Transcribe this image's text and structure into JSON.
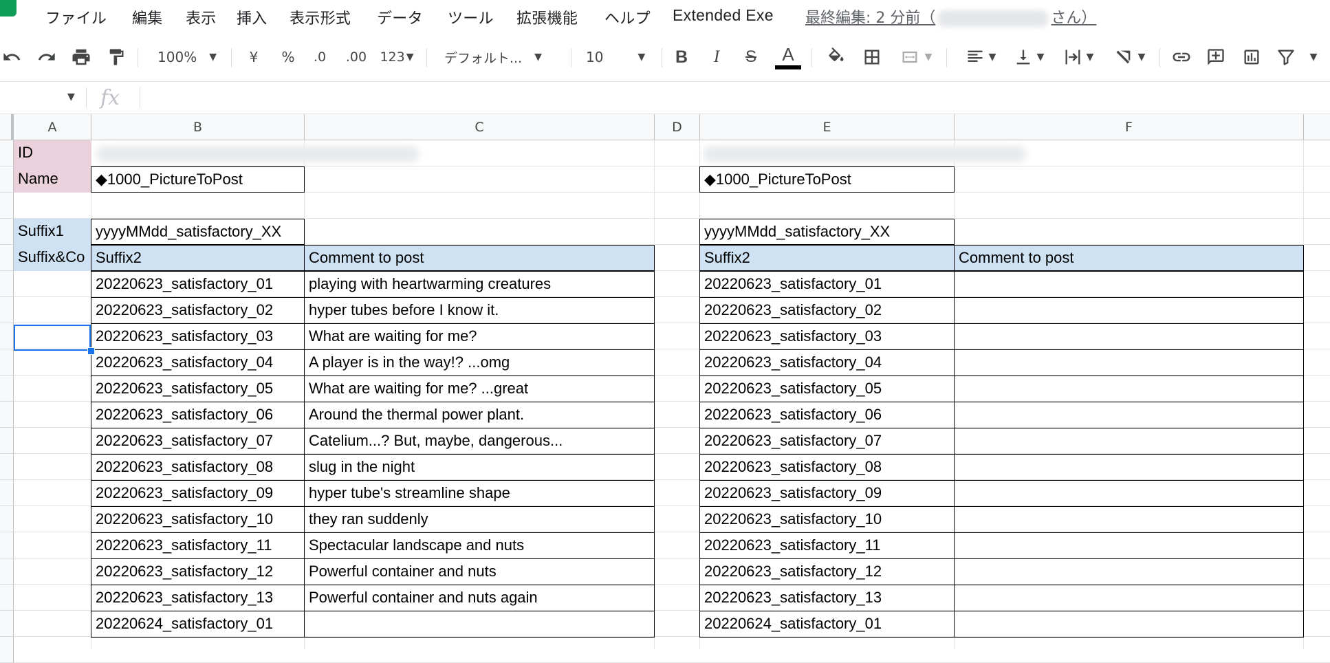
{
  "menu": {
    "items": [
      "ファイル",
      "編集",
      "表示",
      "挿入",
      "表示形式",
      "データ",
      "ツール",
      "拡張機能",
      "ヘルプ",
      "Extended Exe"
    ],
    "last_edit_prefix": "最終編集: 2 分前（",
    "last_edit_suffix": "さん）"
  },
  "toolbar": {
    "zoom": "100%",
    "currency": "¥",
    "percent": "%",
    "decrease_decimal": ".0",
    "increase_decimal": ".00",
    "more_formats": "123",
    "font": "デフォルト...",
    "font_size": "10",
    "bold": "B",
    "italic": "I",
    "strike": "S",
    "text_color_glyph": "A"
  },
  "formula_bar": {
    "fx": "fx",
    "value": ""
  },
  "columns": [
    "A",
    "B",
    "C",
    "D",
    "E",
    "F"
  ],
  "sheet": {
    "a_labels": {
      "id": "ID",
      "name": "Name",
      "suffix1": "Suffix1",
      "suffix_comment": "Suffix&Co"
    },
    "left": {
      "name": "◆1000_PictureToPost",
      "suffix1": "yyyyMMdd_satisfactory_XX",
      "header_suffix2": "Suffix2",
      "header_comment": "Comment to post",
      "rows": [
        {
          "suffix": "20220623_satisfactory_01",
          "comment": "playing with heartwarming creatures"
        },
        {
          "suffix": "20220623_satisfactory_02",
          "comment": "hyper tubes before I know it."
        },
        {
          "suffix": "20220623_satisfactory_03",
          "comment": "What are waiting for me?"
        },
        {
          "suffix": "20220623_satisfactory_04",
          "comment": "A player is in the way!? ...omg"
        },
        {
          "suffix": "20220623_satisfactory_05",
          "comment": "What are waiting for me? ...great"
        },
        {
          "suffix": "20220623_satisfactory_06",
          "comment": "Around the thermal power plant."
        },
        {
          "suffix": "20220623_satisfactory_07",
          "comment": "Catelium...? But, maybe, dangerous..."
        },
        {
          "suffix": "20220623_satisfactory_08",
          "comment": "slug in the night"
        },
        {
          "suffix": "20220623_satisfactory_09",
          "comment": "hyper tube's streamline shape"
        },
        {
          "suffix": "20220623_satisfactory_10",
          "comment": "they ran suddenly"
        },
        {
          "suffix": "20220623_satisfactory_11",
          "comment": "Spectacular landscape and nuts"
        },
        {
          "suffix": "20220623_satisfactory_12",
          "comment": "Powerful container and nuts"
        },
        {
          "suffix": "20220623_satisfactory_13",
          "comment": "Powerful container and nuts again"
        },
        {
          "suffix": "20220624_satisfactory_01",
          "comment": ""
        }
      ]
    },
    "right": {
      "name": "◆1000_PictureToPost",
      "suffix1": "yyyyMMdd_satisfactory_XX",
      "header_suffix2": "Suffix2",
      "header_comment": "Comment to post",
      "rows": [
        {
          "suffix": "20220623_satisfactory_01",
          "comment": ""
        },
        {
          "suffix": "20220623_satisfactory_02",
          "comment": ""
        },
        {
          "suffix": "20220623_satisfactory_03",
          "comment": ""
        },
        {
          "suffix": "20220623_satisfactory_04",
          "comment": ""
        },
        {
          "suffix": "20220623_satisfactory_05",
          "comment": ""
        },
        {
          "suffix": "20220623_satisfactory_06",
          "comment": ""
        },
        {
          "suffix": "20220623_satisfactory_07",
          "comment": ""
        },
        {
          "suffix": "20220623_satisfactory_08",
          "comment": ""
        },
        {
          "suffix": "20220623_satisfactory_09",
          "comment": ""
        },
        {
          "suffix": "20220623_satisfactory_10",
          "comment": ""
        },
        {
          "suffix": "20220623_satisfactory_11",
          "comment": ""
        },
        {
          "suffix": "20220623_satisfactory_12",
          "comment": ""
        },
        {
          "suffix": "20220623_satisfactory_13",
          "comment": ""
        },
        {
          "suffix": "20220624_satisfactory_01",
          "comment": ""
        }
      ]
    }
  },
  "colors": {
    "label_pink": "#ead1dc",
    "header_blue": "#cfe2f3",
    "selection": "#1a73e8"
  }
}
